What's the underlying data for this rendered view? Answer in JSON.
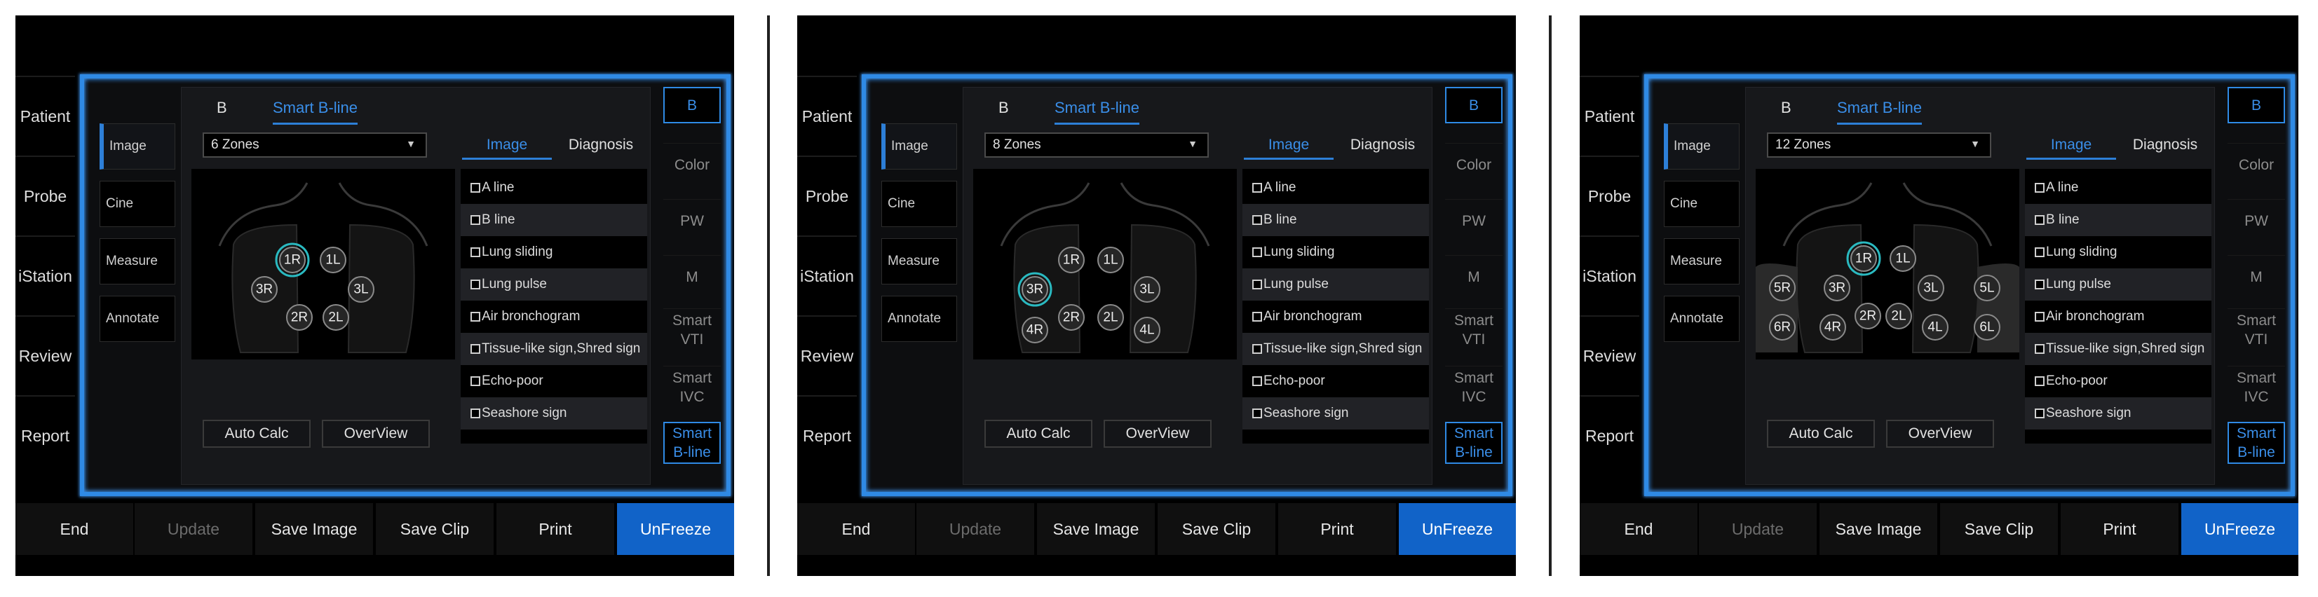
{
  "nav": [
    "Patient",
    "Probe",
    "iStation",
    "Review",
    "Report"
  ],
  "side_tabs": [
    "Image",
    "Cine",
    "Measure",
    "Annotate"
  ],
  "top_tabs": [
    "B",
    "Smart B-line"
  ],
  "sub_tabs": [
    "Image",
    "Diagnosis"
  ],
  "checklist": [
    "A line",
    "B line",
    "Lung sliding",
    "Lung pulse",
    "Air bronchogram",
    "Tissue-like sign,Shred sign",
    "Echo-poor",
    "Seashore sign"
  ],
  "actions": {
    "auto_calc": "Auto Calc",
    "overview": "OverView"
  },
  "modes": [
    "B",
    "Color",
    "PW",
    "M",
    "Smart VTI",
    "Smart IVC",
    "Smart B-line"
  ],
  "bottom": [
    "End",
    "Update",
    "Save Image",
    "Save Clip",
    "Print",
    "UnFreeze"
  ],
  "colors": {
    "accent": "#2f8ae5",
    "primary_button": "#1163c8",
    "selected_zone": "#2ab9c0",
    "background": "#000000"
  },
  "panels": [
    {
      "zone_setting": "6 Zones",
      "selected_zone": "1R",
      "zones": [
        "1R",
        "1L",
        "3R",
        "3L",
        "2R",
        "2L"
      ]
    },
    {
      "zone_setting": "8 Zones",
      "selected_zone": "3R",
      "zones": [
        "1R",
        "1L",
        "3R",
        "3L",
        "2R",
        "2L",
        "4R",
        "4L"
      ]
    },
    {
      "zone_setting": "12 Zones",
      "selected_zone": "1R",
      "zones": [
        "1R",
        "1L",
        "3R",
        "3L",
        "2R",
        "2L",
        "4R",
        "4L",
        "5R",
        "5L",
        "6R",
        "6L"
      ]
    }
  ]
}
